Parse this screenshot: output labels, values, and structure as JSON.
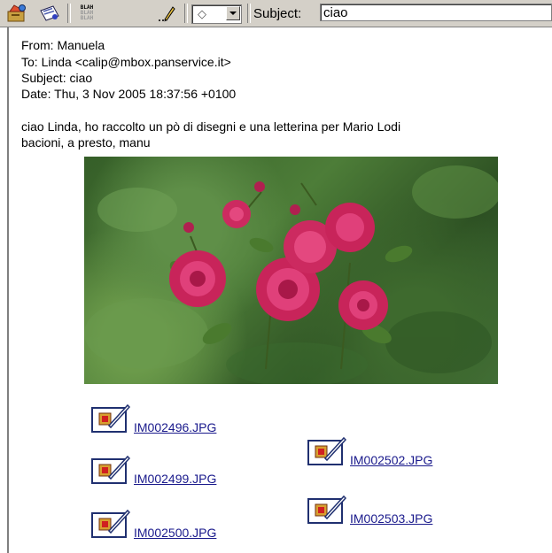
{
  "toolbar": {
    "buttons": [
      {
        "name": "address-book-icon"
      },
      {
        "name": "card-icon"
      },
      {
        "name": "blah-blah-icon",
        "text": [
          "BLAH",
          "BLAH",
          "BLAH"
        ]
      },
      {
        "name": "pencil-icon"
      }
    ],
    "priority_value": "◇",
    "subject_label": "Subject:",
    "subject_value": "ciao"
  },
  "message": {
    "from": "From: Manuela",
    "to": "To: Linda  <calip@mbox.panservice.it>",
    "subject": "Subject: ciao",
    "date": "Date: Thu, 3 Nov 2005 18:37:56 +0100",
    "body": [
      "ciao Linda, ho raccolto un pò di disegni e una letterina per Mario Lodi",
      "bacioni, a presto, manu"
    ]
  },
  "attachments": [
    {
      "name": "IM002496.JPG"
    },
    {
      "name": "IM002499.JPG"
    },
    {
      "name": "IM002500.JPG"
    },
    {
      "name": "IM002502.JPG"
    },
    {
      "name": "IM002503.JPG"
    }
  ],
  "colors": {
    "toolbar_bg": "#d4d0c8",
    "link": "#1a1a8c",
    "rose": "#d8306a"
  }
}
